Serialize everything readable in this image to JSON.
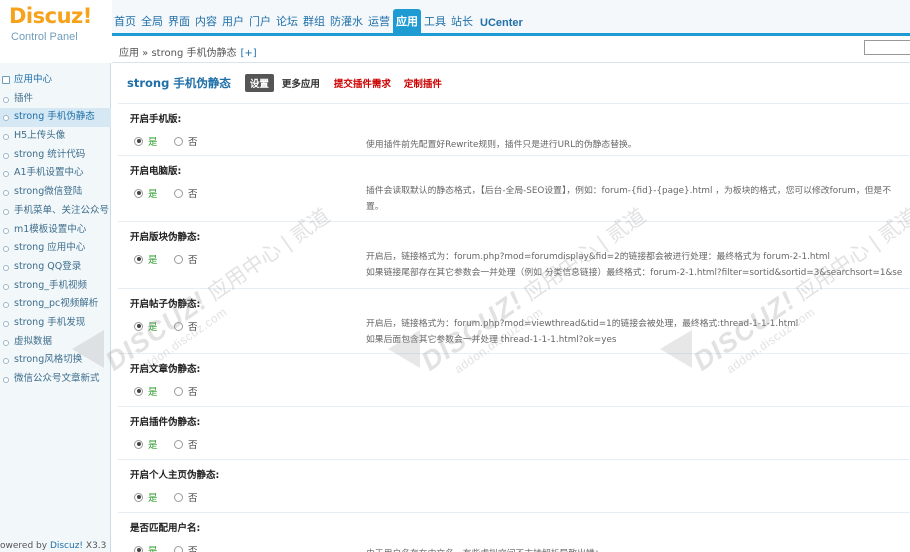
{
  "logo": {
    "brand": "Discuz!",
    "subtitle": "Control Panel"
  },
  "topnav": {
    "items": [
      "首页",
      "全局",
      "界面",
      "内容",
      "用户",
      "门户",
      "论坛",
      "群组",
      "防灌水",
      "运营",
      "应用",
      "工具",
      "站长",
      "UCenter"
    ],
    "active": "应用"
  },
  "breadcrumb": {
    "text": "应用 » strong 手机伪静态",
    "plus": "[+]"
  },
  "sidebar": {
    "items": [
      "应用中心",
      "插件",
      "strong 手机伪静态",
      "H5上传头像",
      "strong 统计代码",
      "A1手机设置中心",
      "strong微信登陆",
      "手机菜单、关注公众号",
      "m1模板设置中心",
      "strong 应用中心",
      "strong QQ登录",
      "strong_手机视频",
      "strong_pc视频解析",
      "strong 手机发现",
      "虚拟数据",
      "strong风格切换",
      "微信公众号文章新式"
    ],
    "active_index": 2,
    "powered_prefix": "owered by",
    "powered_brand": "Discuz!",
    "powered_version": " X3.3"
  },
  "main": {
    "plugin_title": "strong 手机伪静态",
    "tabs": {
      "settings": "设置",
      "more": "更多应用",
      "submit_request": "提交插件需求",
      "custom_plugin": "定制插件"
    },
    "settings": [
      {
        "label": "开启手机版:",
        "yes": "是",
        "no": "否",
        "value": "是",
        "desc": [
          "使用插件前先配置好Rewrite规则，插件只是进行URL的伪静态替换。"
        ]
      },
      {
        "label": "开启电脑版:",
        "yes": "是",
        "no": "否",
        "value": "是",
        "desc": [
          "插件会读取默认的静态格式，【后台-全局-SEO设置】，例如：forum-{fid}-{page}.html ，为板块的格式，您可以修改forum，但是不",
          "置。"
        ]
      },
      {
        "label": "开启版块伪静态:",
        "yes": "是",
        "no": "否",
        "value": "是",
        "desc": [
          "开启后，链接格式为：forum.php?mod=forumdisplay&fid=2的链接都会被进行处理：最终格式为 forum-2-1.html",
          "如果链接尾部存在其它参数会一并处理（例如 分类信息链接）最终格式：forum-2-1.html?filter=sortid&sortid=3&searchsort=1&se"
        ]
      },
      {
        "label": "开启帖子伪静态:",
        "yes": "是",
        "no": "否",
        "value": "是",
        "desc": [
          "开启后，链接格式为：forum.php?mod=viewthread&tid=1的链接会被处理，最终格式:thread-1-1-1.html",
          "如果后面包含其它参数会一并处理 thread-1-1-1.html?ok=yes"
        ]
      },
      {
        "label": "开启文章伪静态:",
        "yes": "是",
        "no": "否",
        "value": "是",
        "desc": []
      },
      {
        "label": "开启插件伪静态:",
        "yes": "是",
        "no": "否",
        "value": "是",
        "desc": []
      },
      {
        "label": "开启个人主页伪静态:",
        "yes": "是",
        "no": "否",
        "value": "是",
        "desc": []
      },
      {
        "label": "是否匹配用户名:",
        "yes": "是",
        "no": "否",
        "value": "是",
        "desc": [
          "由于用户名存在中文名，有些虚拟空间不支持解析导致出错："
        ]
      }
    ]
  },
  "watermark": {
    "brand": "DISCUZ!",
    "url": "addon.discuz.com",
    "cn": "应用中心 | 贰道"
  },
  "colors": {
    "accent": "#1f9bd3",
    "link": "#1f6fa8",
    "logo": "#f7a21b",
    "yes": "#2e9c2e",
    "red": "#cc0000"
  }
}
